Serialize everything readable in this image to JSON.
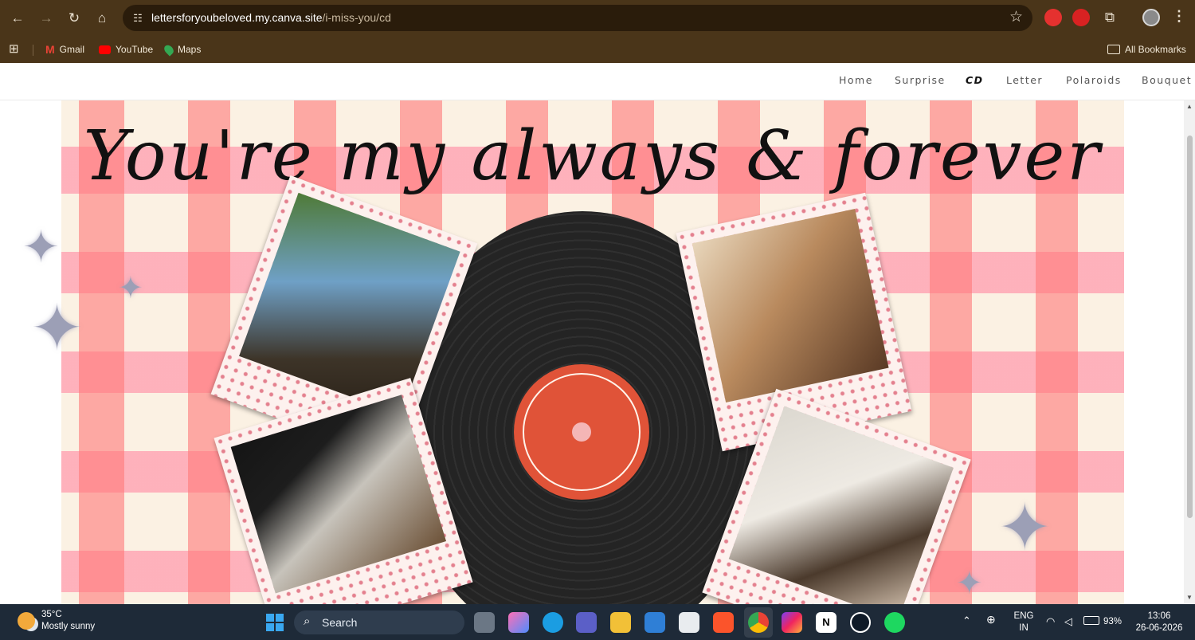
{
  "browser": {
    "url_host": "lettersforyoubeloved.my.canva.site",
    "url_path": "/i-miss-you/cd",
    "bookmarks": [
      {
        "label": "Gmail",
        "icon": "gmail-icon"
      },
      {
        "label": "YouTube",
        "icon": "youtube-icon"
      },
      {
        "label": "Maps",
        "icon": "maps-icon"
      }
    ],
    "all_bookmarks": "All Bookmarks"
  },
  "site_nav": {
    "items": [
      "Home",
      "Surprise",
      "CD",
      "Letter",
      "Polaroids",
      "Bouquet"
    ],
    "active": "CD"
  },
  "page": {
    "headline": "You're my always & forever",
    "colors": {
      "gingham_red": "#ff7b7b",
      "gingham_pink": "#ffa0b4",
      "cream": "#fbf1e3",
      "vinyl": "#242424",
      "label": "#e05338",
      "spindle": "#f4b6b6"
    },
    "polaroids": [
      {
        "name": "polaroid-couple-kiss-outdoors"
      },
      {
        "name": "polaroid-couple-close-up"
      },
      {
        "name": "polaroid-face-masks"
      },
      {
        "name": "polaroid-couple-in-bed"
      }
    ]
  },
  "taskbar": {
    "weather_temp": "35°C",
    "weather_desc": "Mostly sunny",
    "search_label": "Search",
    "lang_top": "ENG",
    "lang_bottom": "IN",
    "battery": "93%",
    "time": "13:06",
    "date": "26-06-2026"
  }
}
